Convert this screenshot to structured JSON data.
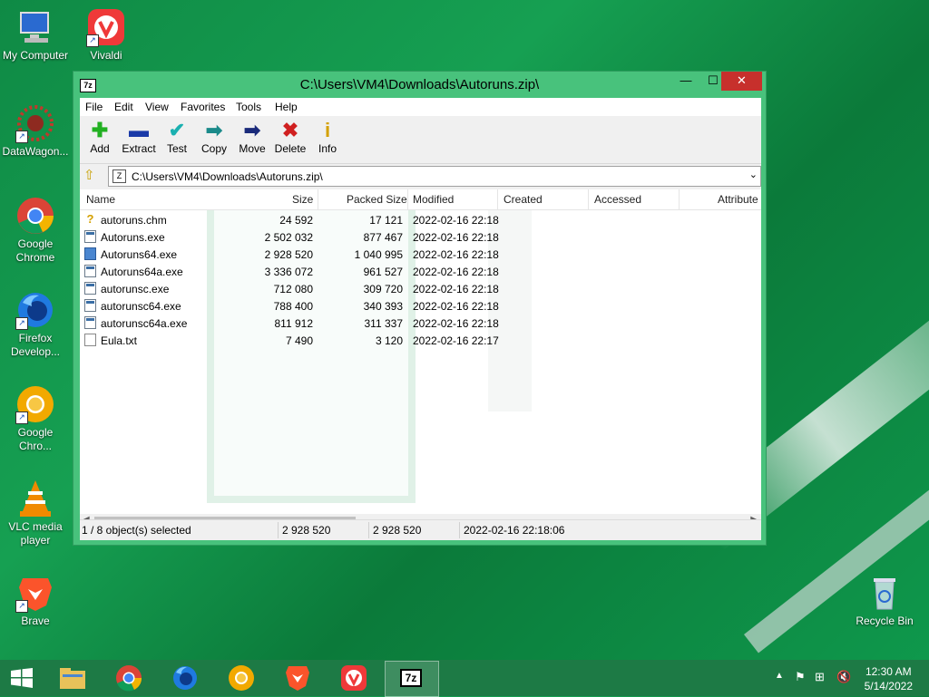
{
  "desktop": {
    "icons": [
      {
        "label": "My Computer",
        "icon": "computer-icon"
      },
      {
        "label": "Vivaldi",
        "icon": "vivaldi-icon"
      },
      {
        "label": "DataWagon...",
        "icon": "datawagon-icon"
      },
      {
        "label": "Google Chrome",
        "icon": "chrome-icon"
      },
      {
        "label": "Firefox Develop...",
        "icon": "firefox-dev-icon"
      },
      {
        "label": "Google Chro...",
        "icon": "chrome-canary-icon"
      },
      {
        "label": "VLC media player",
        "icon": "vlc-icon"
      },
      {
        "label": "Brave",
        "icon": "brave-icon"
      },
      {
        "label": "Recycle Bin",
        "icon": "recycle-bin-icon"
      }
    ]
  },
  "window": {
    "title": "C:\\Users\\VM4\\Downloads\\Autoruns.zip\\",
    "app_icon_text": "7z",
    "minimize_glyph": "—",
    "maximize_glyph": "☐",
    "close_glyph": "✕"
  },
  "menu": [
    "File",
    "Edit",
    "View",
    "Favorites",
    "Tools",
    "Help"
  ],
  "toolbar": [
    {
      "label": "Add",
      "icon": "add-icon",
      "glyph": "✚",
      "color": "#22b022"
    },
    {
      "label": "Extract",
      "icon": "extract-icon",
      "glyph": "▬",
      "color": "#1a3aa8"
    },
    {
      "label": "Test",
      "icon": "test-icon",
      "glyph": "✔",
      "color": "#1ab0b0"
    },
    {
      "label": "Copy",
      "icon": "copy-icon",
      "glyph": "➡",
      "color": "#1a8a8a"
    },
    {
      "label": "Move",
      "icon": "move-icon",
      "glyph": "➡",
      "color": "#1a2a7a"
    },
    {
      "label": "Delete",
      "icon": "delete-icon",
      "glyph": "✖",
      "color": "#d02020"
    },
    {
      "label": "Info",
      "icon": "info-icon",
      "glyph": "i",
      "color": "#d4a000"
    }
  ],
  "address": {
    "path": "C:\\Users\\VM4\\Downloads\\Autoruns.zip\\",
    "zip_glyph": "Z"
  },
  "columns": [
    "Name",
    "Size",
    "Packed Size",
    "Modified",
    "Created",
    "Accessed",
    "Attribute"
  ],
  "files": [
    {
      "name": "autoruns.chm",
      "size": "24 592",
      "packed": "17 121",
      "modified": "2022-02-16 22:18",
      "type": "chm"
    },
    {
      "name": "Autoruns.exe",
      "size": "2 502 032",
      "packed": "877 467",
      "modified": "2022-02-16 22:18",
      "type": "exe"
    },
    {
      "name": "Autoruns64.exe",
      "size": "2 928 520",
      "packed": "1 040 995",
      "modified": "2022-02-16 22:18",
      "type": "exeblue"
    },
    {
      "name": "Autoruns64a.exe",
      "size": "3 336 072",
      "packed": "961 527",
      "modified": "2022-02-16 22:18",
      "type": "exe"
    },
    {
      "name": "autorunsc.exe",
      "size": "712 080",
      "packed": "309 720",
      "modified": "2022-02-16 22:18",
      "type": "exe"
    },
    {
      "name": "autorunsc64.exe",
      "size": "788 400",
      "packed": "340 393",
      "modified": "2022-02-16 22:18",
      "type": "exe"
    },
    {
      "name": "autorunsc64a.exe",
      "size": "811 912",
      "packed": "311 337",
      "modified": "2022-02-16 22:18",
      "type": "exe"
    },
    {
      "name": "Eula.txt",
      "size": "7 490",
      "packed": "3 120",
      "modified": "2022-02-16 22:17",
      "type": "txt"
    }
  ],
  "status": {
    "selection": "1 / 8 object(s) selected",
    "size": "2 928 520",
    "packed": "2 928 520",
    "modified": "2022-02-16 22:18:06"
  },
  "taskbar": {
    "start_icon": "windows-start-icon",
    "apps": [
      "file-explorer-icon",
      "chrome-icon",
      "firefox-icon",
      "chrome-canary-icon",
      "brave-icon",
      "vivaldi-icon",
      "7zip-icon"
    ],
    "active_app_text": "7z",
    "time": "12:30 AM",
    "date": "5/14/2022"
  }
}
